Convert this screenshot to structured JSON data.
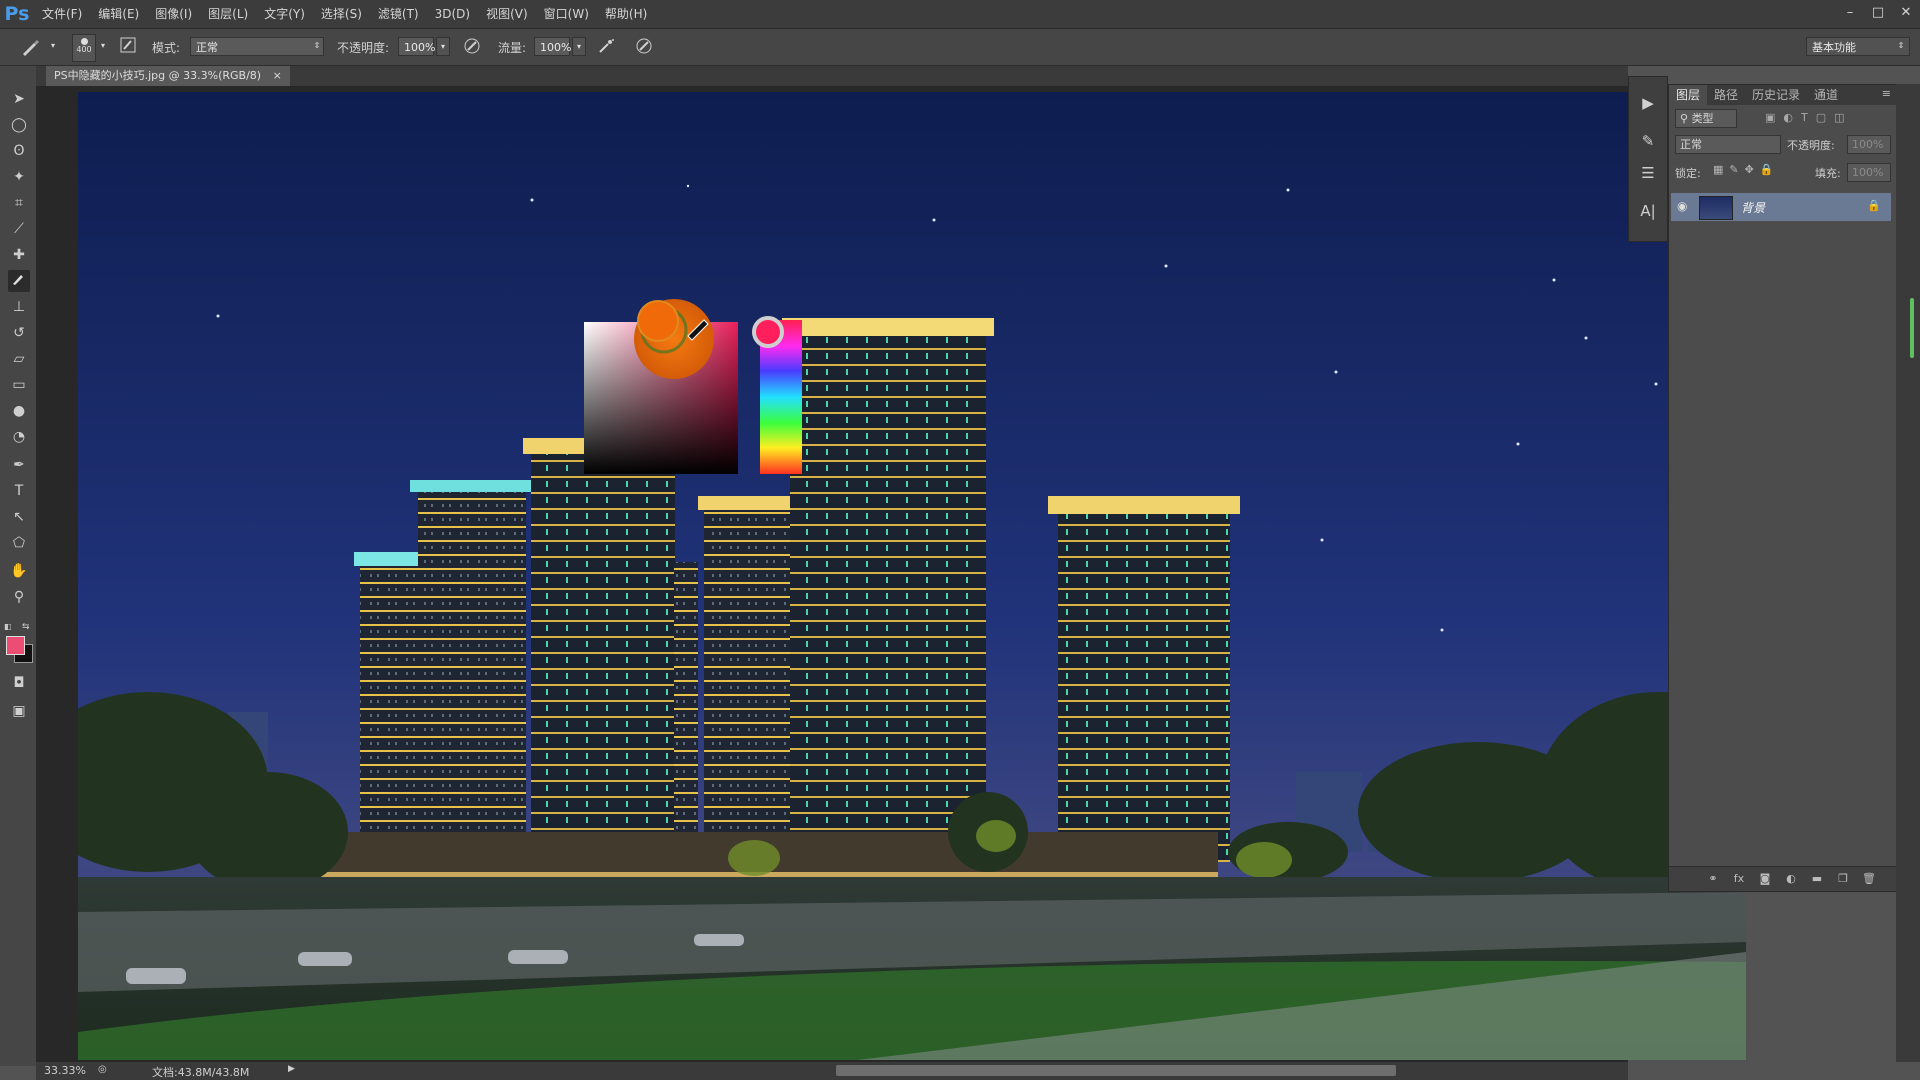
{
  "app": {
    "logo": "Ps"
  },
  "menu": [
    "文件(F)",
    "编辑(E)",
    "图像(I)",
    "图层(L)",
    "文字(Y)",
    "选择(S)",
    "滤镜(T)",
    "3D(D)",
    "视图(V)",
    "窗口(W)",
    "帮助(H)"
  ],
  "window_controls": [
    "–",
    "□",
    "✕"
  ],
  "options": {
    "brush_size": "400",
    "mode_label": "模式:",
    "mode_value": "正常",
    "opacity_label": "不透明度:",
    "opacity_value": "100%",
    "flow_label": "流量:",
    "flow_value": "100%",
    "workspace": "基本功能"
  },
  "document": {
    "tab_title": "PS中隐藏的小技巧.jpg @ 33.3%(RGB/8)",
    "close": "×"
  },
  "layers_panel": {
    "tabs": [
      "图层",
      "路径",
      "历史记录",
      "通道"
    ],
    "filter_label": "类型",
    "blend_mode": "正常",
    "opacity_label": "不透明度:",
    "opacity_value": "100%",
    "lock_label": "锁定:",
    "fill_label": "填充:",
    "fill_value": "100%",
    "layer_name": "背景"
  },
  "status": {
    "zoom": "33.33%",
    "doc_size": "文档:43.8M/43.8M"
  },
  "colors": {
    "foreground": "#ec4d74",
    "background": "#111111",
    "picked": "#f06a0a",
    "hue_selected": "#ff1f5c"
  }
}
